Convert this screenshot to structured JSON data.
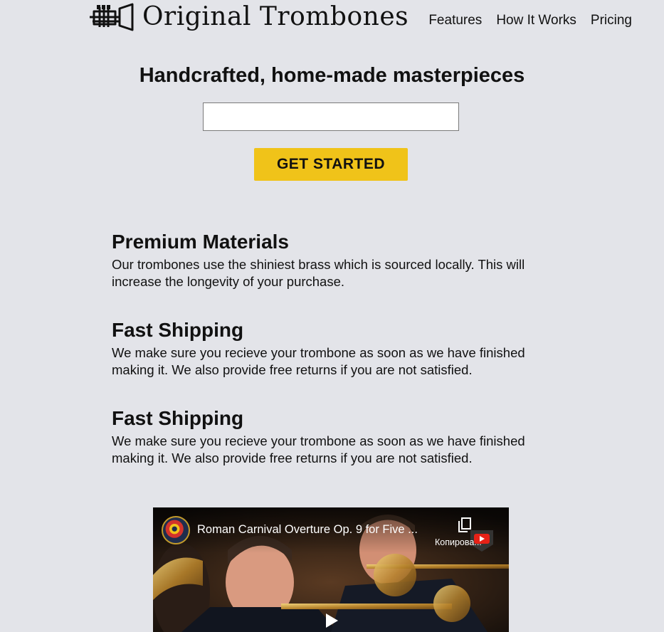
{
  "header": {
    "brand_name": "Original Trombones",
    "logo_icon": "trumpet-icon",
    "nav": [
      {
        "label": "Features"
      },
      {
        "label": "How It Works"
      },
      {
        "label": "Pricing"
      }
    ]
  },
  "hero": {
    "title": "Handcrafted, home-made masterpieces",
    "email_placeholder": "",
    "cta_label": "GET STARTED"
  },
  "features": [
    {
      "title": "Premium Materials",
      "text": "Our trombones use the shiniest brass which is sourced locally. This will increase the longevity of your purchase."
    },
    {
      "title": "Fast Shipping",
      "text": "We make sure you recieve your trombone as soon as we have finished making it. We also provide free returns if you are not satisfied."
    },
    {
      "title": "Fast Shipping",
      "text": "We make sure you recieve your trombone as soon as we have finished making it. We also provide free returns if you are not satisfied."
    }
  ],
  "video": {
    "title": "Roman Carnival Overture Op. 9 for Five ...",
    "copy_label": "Копирова...",
    "icons": [
      "copy-link-icon",
      "youtube-badge-icon",
      "play-icon",
      "channel-avatar-icon"
    ]
  },
  "colors": {
    "background": "#e3e4e9",
    "accent": "#f0c319",
    "text": "#111111"
  }
}
